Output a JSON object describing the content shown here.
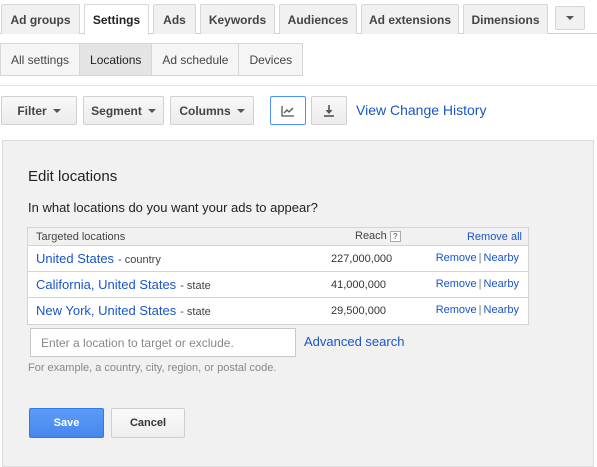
{
  "tabs": [
    {
      "label": "Ad groups",
      "active": false
    },
    {
      "label": "Settings",
      "active": true
    },
    {
      "label": "Ads",
      "active": false
    },
    {
      "label": "Keywords",
      "active": false
    },
    {
      "label": "Audiences",
      "active": false
    },
    {
      "label": "Ad extensions",
      "active": false
    },
    {
      "label": "Dimensions",
      "active": false
    }
  ],
  "subtabs": [
    {
      "label": "All settings",
      "active": false
    },
    {
      "label": "Locations",
      "active": true
    },
    {
      "label": "Ad schedule",
      "active": false
    },
    {
      "label": "Devices",
      "active": false
    }
  ],
  "toolbar": {
    "filter_label": "Filter",
    "segment_label": "Segment",
    "columns_label": "Columns",
    "graph_icon": "line-chart-icon",
    "download_icon": "download-icon",
    "change_history_link": "View Change History"
  },
  "edit_locations": {
    "title": "Edit locations",
    "question": "In what locations do you want your ads to appear?",
    "table": {
      "header_targeted": "Targeted locations",
      "header_reach": "Reach",
      "help_icon_glyph": "?",
      "remove_all_label": "Remove all",
      "rows": [
        {
          "name": "United States",
          "type": "- country",
          "reach": "227,000,000",
          "remove": "Remove",
          "nearby": "Nearby"
        },
        {
          "name": "California, United States",
          "type": "- state",
          "reach": "41,000,000",
          "remove": "Remove",
          "nearby": "Nearby"
        },
        {
          "name": "New York, United States",
          "type": "- state",
          "reach": "29,500,000",
          "remove": "Remove",
          "nearby": "Nearby"
        }
      ]
    },
    "search_placeholder": "Enter a location to target or exclude.",
    "advanced_search_label": "Advanced search",
    "hint": "For example, a country, city, region, or postal code.",
    "save_label": "Save",
    "cancel_label": "Cancel"
  },
  "colors": {
    "link": "#1a55c9",
    "save_button": "#4787ed",
    "panel_background": "#f1f1f1"
  }
}
